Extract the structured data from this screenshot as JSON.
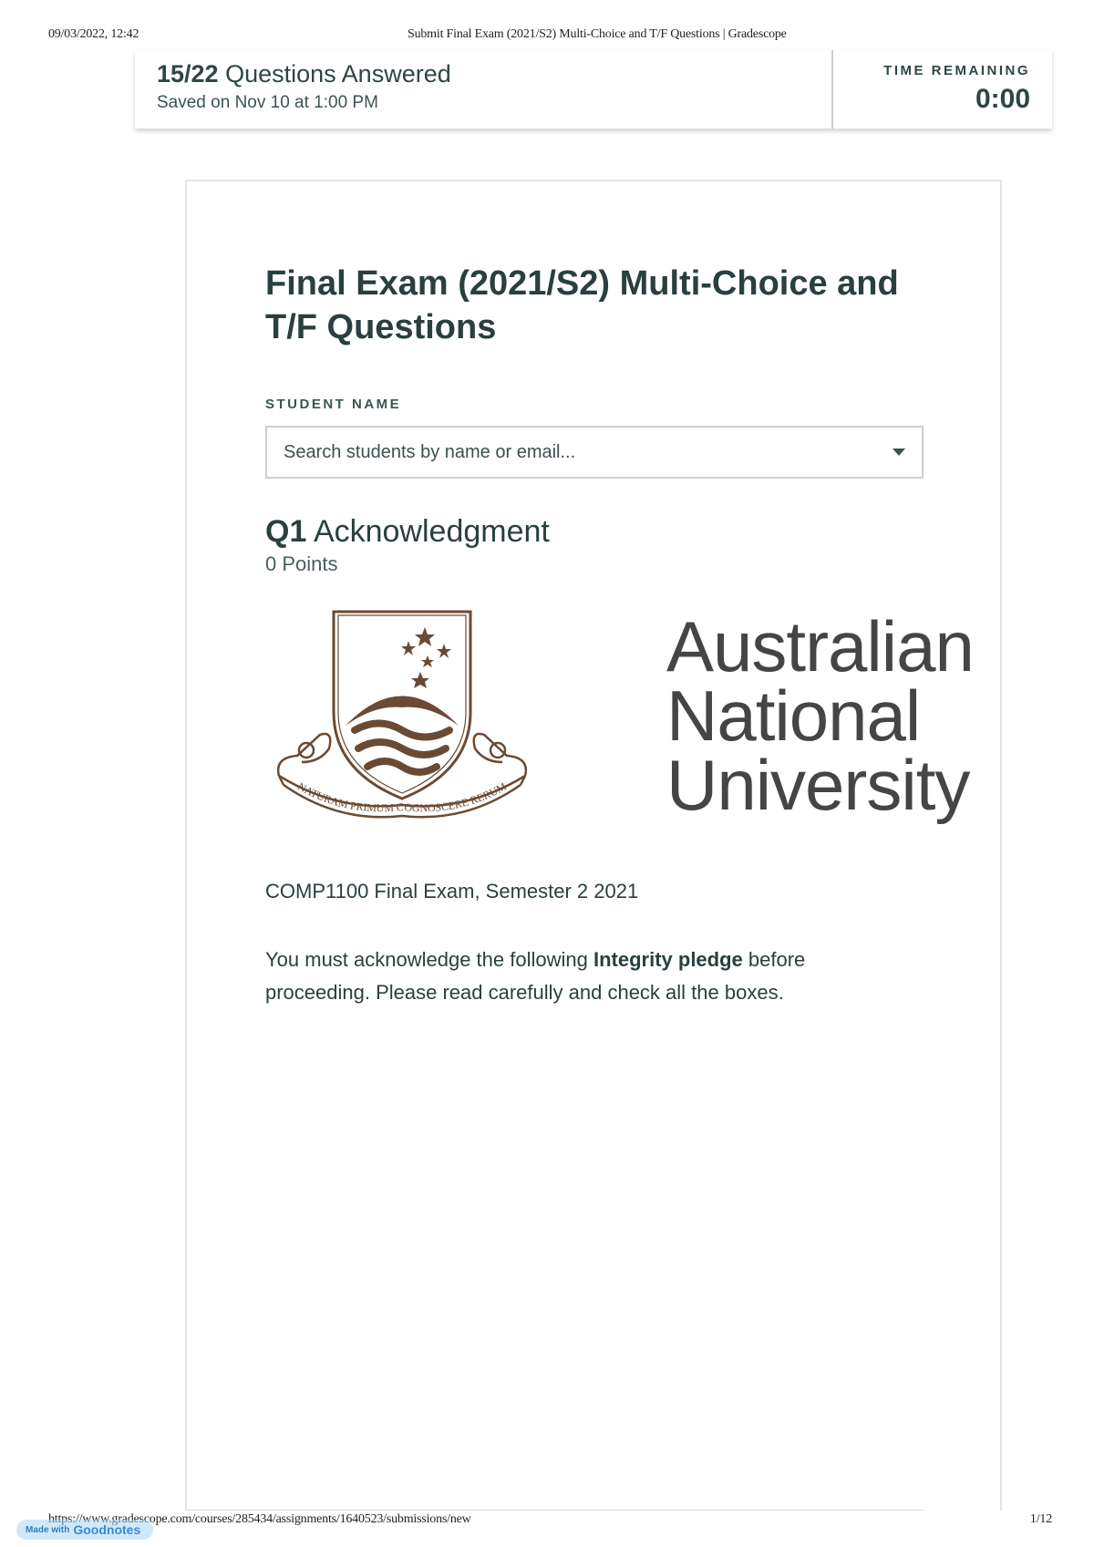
{
  "print_header": {
    "datetime": "09/03/2022, 12:42",
    "title": "Submit Final Exam (2021/S2) Multi-Choice and T/F Questions | Gradescope"
  },
  "status": {
    "answered_count": "15/22",
    "answered_label": "Questions Answered",
    "saved": "Saved on Nov 10 at 1:00 PM",
    "time_label": "TIME REMAINING",
    "time_value": "0:00"
  },
  "exam": {
    "title": "Final Exam (2021/S2) Multi-Choice and T/F Questions",
    "student_label": "STUDENT NAME",
    "student_placeholder": "Search students by name or email..."
  },
  "question": {
    "number": "Q1",
    "title": "Acknowledgment",
    "points": "0 Points",
    "logo": {
      "motto": "NATURAM PRIMUM COGNOSCERE RERUM",
      "word1": "Australian",
      "word2": "National",
      "word3": "University",
      "color": "#6b4a33"
    },
    "course": "COMP1100 Final Exam, Semester 2 2021",
    "pledge_before": "You must acknowledge the following ",
    "pledge_bold": "Integrity pledge",
    "pledge_after": " before proceeding. Please read carefully and check all the boxes."
  },
  "print_footer": {
    "url": "https://www.gradescope.com/courses/285434/assignments/1640523/submissions/new",
    "page": "1/12"
  },
  "watermark": {
    "prefix": "Made with",
    "brand": "Goodnotes"
  }
}
